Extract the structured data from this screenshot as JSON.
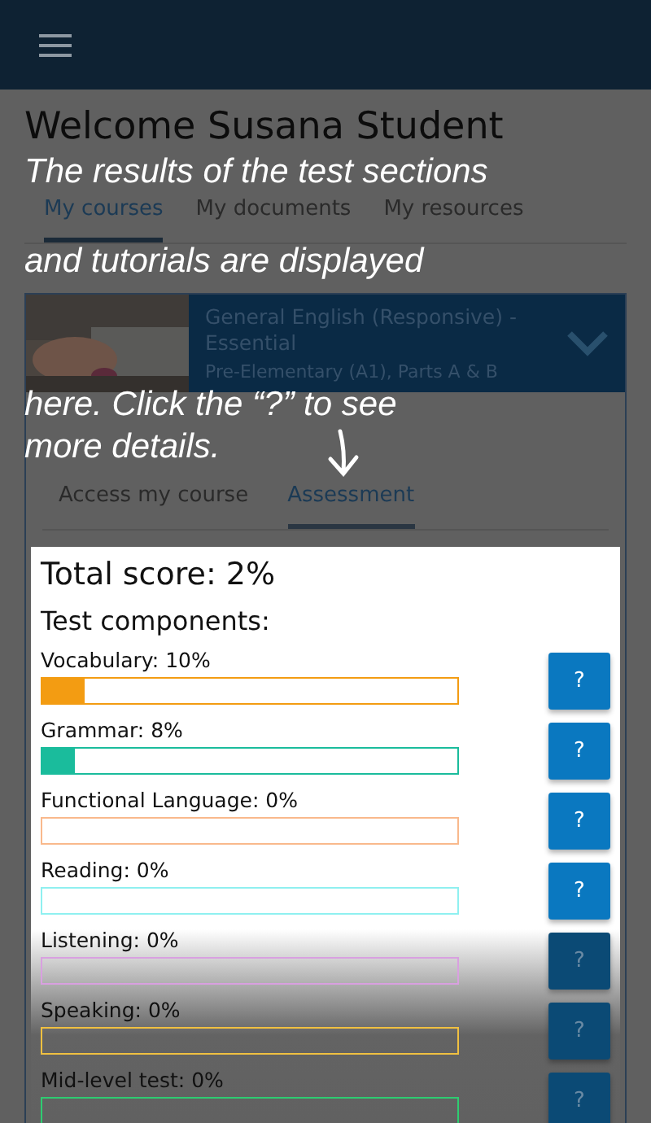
{
  "welcome": "Welcome Susana Student",
  "nav_tabs": [
    {
      "label": "My courses",
      "selected": true
    },
    {
      "label": "My documents",
      "selected": false
    },
    {
      "label": "My resources",
      "selected": false
    }
  ],
  "course": {
    "title": "General English (Responsive) - Essential",
    "level": "Pre-Elementary (A1), Parts A & B",
    "expanded": true
  },
  "course_tabs": [
    {
      "label": "Access my course",
      "selected": false
    },
    {
      "label": "Assessment",
      "selected": true
    }
  ],
  "total_score": "Total score: 2%",
  "components_heading": "Test components:",
  "components": [
    {
      "label": "Vocabulary: 10%",
      "level": 0.1,
      "color": "#f39c12",
      "button": "?"
    },
    {
      "label": "Grammar: 8%",
      "level": 0.08,
      "color": "#1abc9c",
      "button": "?"
    },
    {
      "label": "Functional Language: 0%",
      "level": 0,
      "color": "#f9b98c",
      "button": "?"
    },
    {
      "label": "Reading: 0%",
      "level": 0,
      "color": "#8ff0f0",
      "button": "?"
    },
    {
      "label": "Listening: 0%",
      "level": 0,
      "color": "#d9a0e0",
      "button": "?"
    },
    {
      "label": "Speaking: 0%",
      "level": 0,
      "color": "#f0c040",
      "button": "?"
    },
    {
      "label": "Mid-level test: 0%",
      "level": 0,
      "color": "#2ecc71",
      "button": "?"
    }
  ],
  "tutorial": {
    "lines": [
      "The results of the test sections",
      "and tutorials are displayed",
      "here. Click the “?” to see",
      "more details."
    ]
  }
}
